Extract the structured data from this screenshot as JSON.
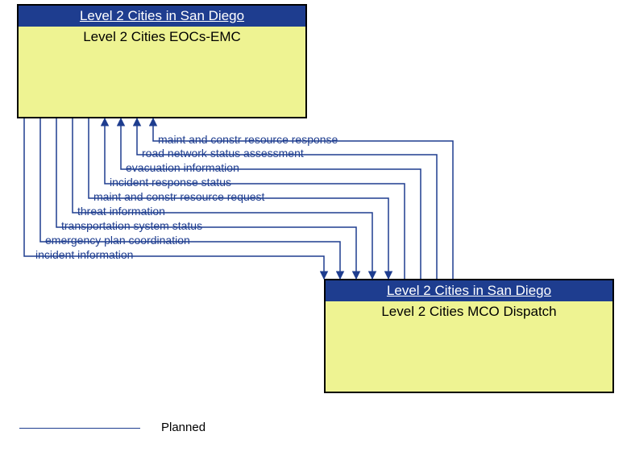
{
  "nodes": {
    "topLeft": {
      "header": "Level 2 Cities in San Diego",
      "sub": "Level 2 Cities EOCs-EMC"
    },
    "bottomRight": {
      "header": "Level 2 Cities in San Diego",
      "sub": "Level 2 Cities MCO Dispatch"
    }
  },
  "flows": [
    {
      "label": "maint and constr resource response",
      "dir": "toTop"
    },
    {
      "label": "road network status assessment",
      "dir": "toTop"
    },
    {
      "label": "evacuation information",
      "dir": "toTop"
    },
    {
      "label": "incident response status",
      "dir": "toTop"
    },
    {
      "label": "maint and constr resource request",
      "dir": "toBottom"
    },
    {
      "label": "threat information",
      "dir": "toBottom"
    },
    {
      "label": "transportation system status",
      "dir": "toBottom"
    },
    {
      "label": "emergency plan coordination",
      "dir": "toBottom"
    },
    {
      "label": "incident information",
      "dir": "toBottom"
    }
  ],
  "legend": {
    "planned": "Planned"
  },
  "colors": {
    "line": "#1e3d8f",
    "headerBg": "#1e3d8f",
    "nodeBg": "#eef392"
  }
}
